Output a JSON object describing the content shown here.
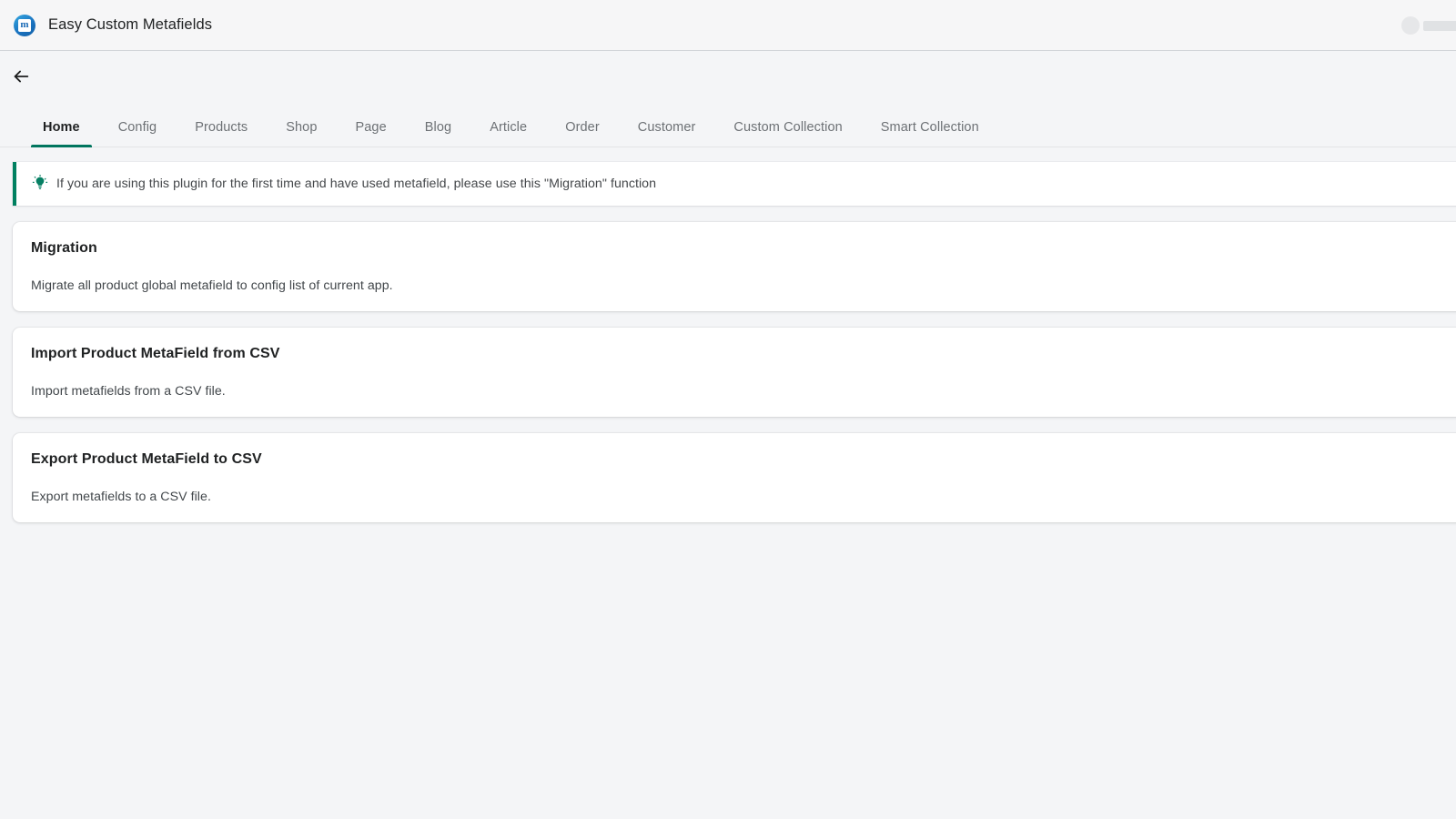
{
  "appbar": {
    "logo_letter": "m",
    "title": "Easy Custom Metafields"
  },
  "navigation": {
    "back_label": "←"
  },
  "tabs": [
    {
      "label": "Home",
      "active": true
    },
    {
      "label": "Config",
      "active": false
    },
    {
      "label": "Products",
      "active": false
    },
    {
      "label": "Shop",
      "active": false
    },
    {
      "label": "Page",
      "active": false
    },
    {
      "label": "Blog",
      "active": false
    },
    {
      "label": "Article",
      "active": false
    },
    {
      "label": "Order",
      "active": false
    },
    {
      "label": "Customer",
      "active": false
    },
    {
      "label": "Custom Collection",
      "active": false
    },
    {
      "label": "Smart Collection",
      "active": false
    }
  ],
  "banner": {
    "text": "If you are using this plugin for the first time and have used metafield, please use this \"Migration\" function",
    "accent_color": "#008060"
  },
  "cards": [
    {
      "title": "Migration",
      "description": "Migrate all product global metafield to config list of current app."
    },
    {
      "title": "Import Product MetaField from CSV",
      "description": "Import metafields from a CSV file."
    },
    {
      "title": "Export Product MetaField to CSV",
      "description": "Export metafields to a CSV file."
    }
  ],
  "colors": {
    "page_background": "#f4f5f7",
    "appbar_background": "#f6f6f7",
    "active_tab": "#00755e",
    "logo_blue": "#1a73c0"
  }
}
